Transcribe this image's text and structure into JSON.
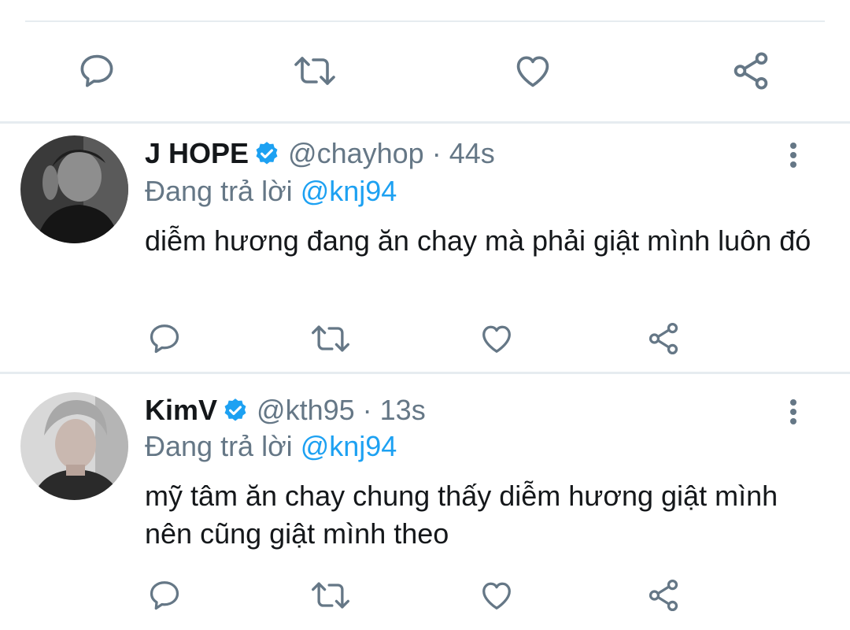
{
  "colors": {
    "accent": "#1da1f2",
    "icon": "#657786",
    "text": "#14171a",
    "divider": "#e6ecf0"
  },
  "top_actions": {
    "icons": [
      "comment-icon",
      "retweet-icon",
      "heart-icon",
      "share-icon"
    ]
  },
  "tweets": [
    {
      "name": "J HOPE",
      "handle": "@chayhop",
      "separator": "·",
      "time": "44s",
      "replying_prefix": "Đang trả lời",
      "replying_to": "@knj94",
      "text": "diễm hương đang ăn chay mà phải giật mình luôn đó",
      "verified": true
    },
    {
      "name": "KimV",
      "handle": "@kth95",
      "separator": "·",
      "time": "13s",
      "replying_prefix": "Đang trả lời",
      "replying_to": "@knj94",
      "text": "mỹ tâm ăn chay chung thấy diễm hương giật mình nên cũng giật mình theo",
      "verified": true
    }
  ]
}
